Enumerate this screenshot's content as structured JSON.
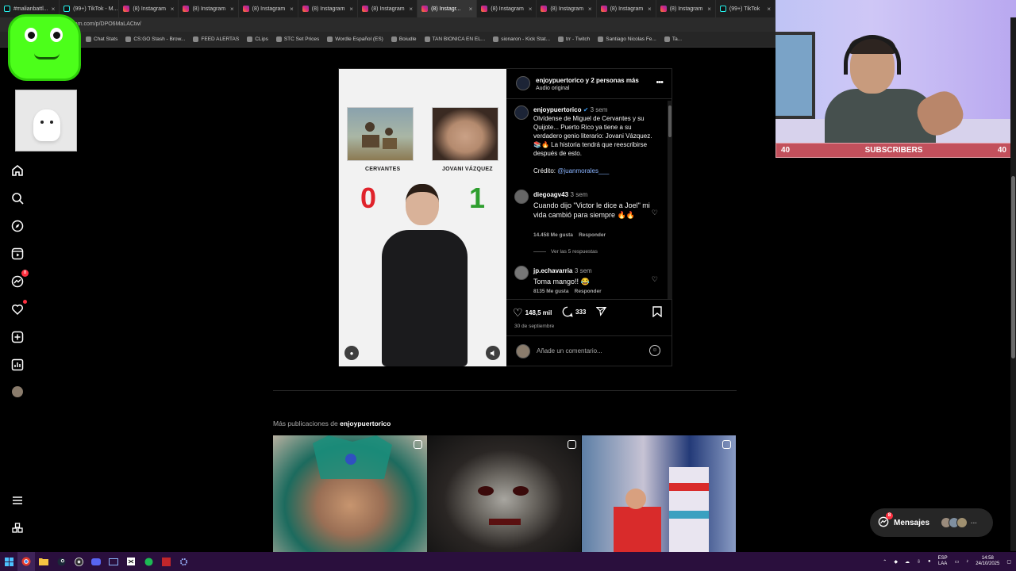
{
  "browser": {
    "tabs": [
      {
        "label": "#malianbattl...",
        "kind": "tiktok"
      },
      {
        "label": "(99+) TikTok - M...",
        "kind": "tiktok"
      },
      {
        "label": "(8) Instagram",
        "kind": "instagram"
      },
      {
        "label": "(8) Instagram",
        "kind": "instagram"
      },
      {
        "label": "(8) Instagram",
        "kind": "instagram"
      },
      {
        "label": "(8) Instagram",
        "kind": "instagram"
      },
      {
        "label": "(8) Instagram",
        "kind": "instagram"
      },
      {
        "label": "(8) Instagr...",
        "kind": "instagram",
        "active": true
      },
      {
        "label": "(8) Instagram",
        "kind": "instagram"
      },
      {
        "label": "(8) Instagram",
        "kind": "instagram"
      },
      {
        "label": "(8) Instagram",
        "kind": "instagram"
      },
      {
        "label": "(8) Instagram",
        "kind": "instagram"
      },
      {
        "label": "(99+) TikTok",
        "kind": "tiktok"
      }
    ],
    "url": "...am.com/p/DPO6MaLACtw/",
    "bookmarks": [
      "Chat Stats",
      "CS:GO Stash - Brow...",
      "FEED ALERTAS",
      "CLips",
      "STC Set Prices",
      "Wordle Español (ES)",
      "Boiudle",
      "TAN BIONICA EN EL...",
      "sionaron - Kick Stat...",
      "trr - Twitch",
      "Santiago Nicolas Fe...",
      "Ta..."
    ]
  },
  "post": {
    "header_name": "enjoypuertorico y 2 personas más",
    "header_sub": "Audio original",
    "media": {
      "left_label": "CERVANTES",
      "right_label": "JOVANI VÁZQUEZ",
      "left_score": "0",
      "right_score": "1"
    },
    "caption": {
      "user": "enjoypuertorico",
      "time": "3 sem",
      "text": "Olvídense de Miguel de Cervantes y su Quijote... Puerto Rico ya tiene a su verdadero genio literario: Jovani Vázquez. 📚🔥 La historia tendrá que reescribirse después de esto.",
      "credit_label": "Crédito:",
      "credit_link": "@juanmorales___"
    },
    "comments": [
      {
        "user": "diegoagv43",
        "time": "3 sem",
        "text": "Cuando dijo \"Victor le dice a Joel\" mi vida cambió para siempre 🔥🔥",
        "likes": "14.458 Me gusta",
        "reply": "Responder",
        "replies": "Ver las 5 respuestas"
      },
      {
        "user": "jp.echavarria",
        "time": "3 sem",
        "text": "Toma mango!! 😂",
        "likes": "8135 Me gusta",
        "reply": "Responder"
      }
    ],
    "likes": "148,5 mil",
    "comment_count": "333",
    "date": "30 de septiembre",
    "comment_placeholder": "Añade un comentario..."
  },
  "more": {
    "prefix": "Más publicaciones de",
    "user": "enjoypuertorico"
  },
  "messages": {
    "label": "Mensajes",
    "badge": "8"
  },
  "nav": {
    "notif_badge": "8"
  },
  "overlay": {
    "subs_label": "SUBSCRIBERS",
    "subs_left": "40",
    "subs_right": "40"
  },
  "taskbar": {
    "lang": "ESP",
    "lang2": "LAA",
    "time": "14:58",
    "date": "24/10/2025"
  }
}
